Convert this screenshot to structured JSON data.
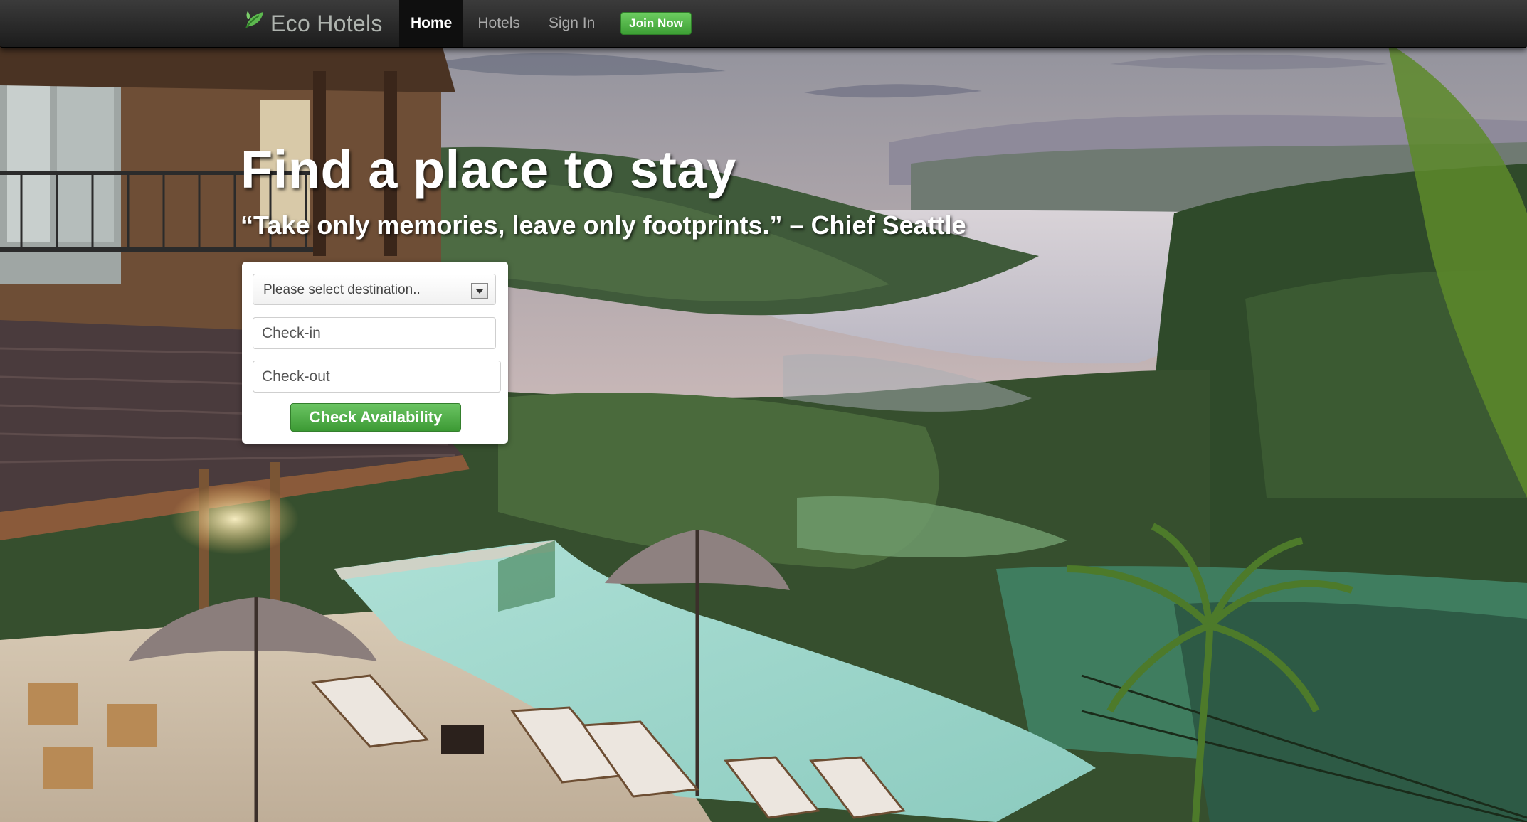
{
  "nav": {
    "brand": "Eco Hotels",
    "brand_icon": "leaf-icon",
    "items": [
      {
        "label": "Home",
        "active": true
      },
      {
        "label": "Hotels",
        "active": false
      },
      {
        "label": "Sign In",
        "active": false
      }
    ],
    "join_label": "Join Now"
  },
  "hero": {
    "title": "Find a place to stay",
    "quote": "“Take only memories, leave only footprints.” – Chief Seattle"
  },
  "search": {
    "destination_value": "Please select destination..",
    "checkin_placeholder": "Check-in",
    "checkout_placeholder": "Check-out",
    "submit_label": "Check Availability"
  },
  "colors": {
    "accent_green": "#4caf45",
    "navbar": "#222222"
  }
}
